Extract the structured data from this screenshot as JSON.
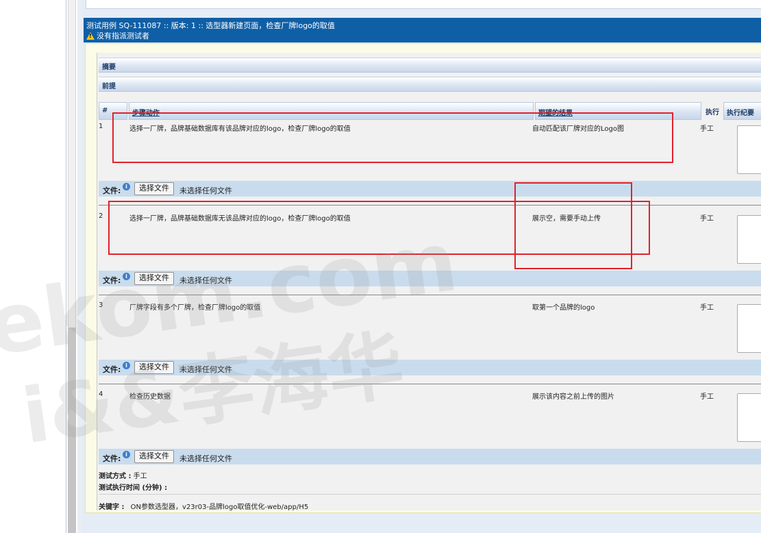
{
  "header": {
    "title": "测试用例 SQ-111087 :: 版本: 1 :: 选型器新建页面，检查厂牌logo的取值",
    "warning": "没有指派测试者"
  },
  "sections": {
    "summary": "摘要",
    "preconditions": "前提"
  },
  "columns": {
    "num": "#",
    "step": "步骤动作",
    "expected": "期望的结果",
    "exec": "执行",
    "notes": "执行纪要"
  },
  "steps": [
    {
      "num": "1",
      "action": "选择一厂牌，品牌基础数据库有该品牌对应的logo，检查厂牌logo的取值",
      "expected": "自动匹配该厂牌对应的Logo图",
      "exec": "手工"
    },
    {
      "num": "2",
      "action": "选择一厂牌，品牌基础数据库无该品牌对应的logo，检查厂牌logo的取值",
      "expected": "展示空，需要手动上传",
      "exec": "手工"
    },
    {
      "num": "3",
      "action": "厂牌字段有多个厂牌，检查厂牌logo的取值",
      "expected": "取第一个品牌的logo",
      "exec": "手工"
    },
    {
      "num": "4",
      "action": "检查历史数据",
      "expected": "展示该内容之前上传的图片",
      "exec": "手工"
    }
  ],
  "file": {
    "label": "文件:",
    "button": "选择文件",
    "none": "未选择任何文件"
  },
  "footer": {
    "method_label": "测试方式 :",
    "method_value": "手工",
    "time_label": "测试执行时间 (分钟) :",
    "keywords_label": "关键字 :",
    "keywords_value": "ON参数选型器，v23r03-品牌logo取值优化-web/app/H5"
  },
  "watermark": {
    "line1": "ekom.com",
    "line2": "i&&李海华"
  },
  "colors": {
    "header_bg": "#0f5fa6",
    "highlight_red": "#e2212b",
    "file_bar": "#c9dced"
  }
}
